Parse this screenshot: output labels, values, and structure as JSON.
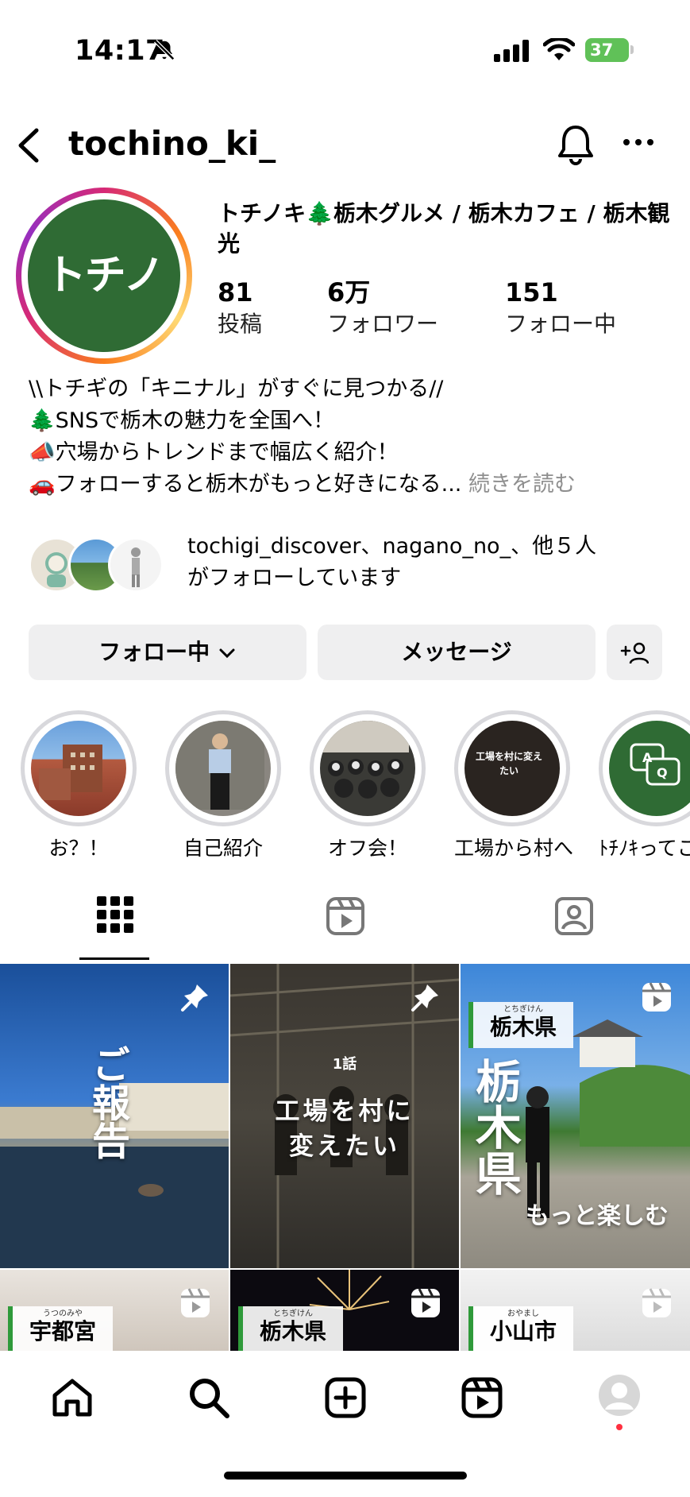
{
  "status_bar": {
    "time": "14:17",
    "battery": "37"
  },
  "header": {
    "username": "tochino_ki_"
  },
  "profile": {
    "logo_text": "トチノキ",
    "display_name": "トチノキ🌲栃木グルメ / 栃木カフェ / 栃木観光",
    "stats": [
      {
        "value": "81",
        "label": "投稿"
      },
      {
        "value": "6万",
        "label": "フォロワー"
      },
      {
        "value": "151",
        "label": "フォロー中"
      }
    ],
    "bio": [
      "\\\\トチギの「キニナル」がすぐに見つかる//",
      "🌲SNSで栃木の魅力を全国へ！",
      "📣穴場からトレンドまで幅広く紹介！",
      "🚗フォローすると栃木がもっと好きになる..."
    ],
    "bio_more": "続きを読む",
    "followed_by_line1": "tochigi_discover、nagano_no_、他５人",
    "followed_by_line2": "がフォローしています"
  },
  "actions": {
    "following": "フォロー中",
    "message": "メッセージ"
  },
  "highlights": [
    {
      "label": "お？！"
    },
    {
      "label": "自己紹介"
    },
    {
      "label": "オフ会！"
    },
    {
      "label": "工場から村へ",
      "inner_text": "工場を村に変えたい"
    },
    {
      "label": "ﾄﾁﾉｷってこ"
    }
  ],
  "posts": [
    {
      "text": "ご報告",
      "type": "pinned"
    },
    {
      "kicker": "1話",
      "text_line1": "工場を村に",
      "text_line2": "変えたい",
      "type": "pinned"
    },
    {
      "tag": "栃木県",
      "tag_ruby": "とちぎけん",
      "big": "栃木県",
      "text": "もっと楽しむ",
      "type": "reel"
    },
    {
      "tag": "宇都宮",
      "tag_ruby": "うつのみや",
      "type": "reel"
    },
    {
      "tag": "栃木県",
      "tag_ruby": "とちぎけん",
      "type": "reel"
    },
    {
      "tag": "小山市",
      "tag_ruby": "おやまし",
      "type": "reel"
    }
  ],
  "highlight_inner_text": "工場を村に変えたい",
  "colors": {
    "brand_green": "#2f6b34",
    "battery_green": "#60c158",
    "button_bg": "#efeff0",
    "notification_dot": "#ff3040"
  }
}
